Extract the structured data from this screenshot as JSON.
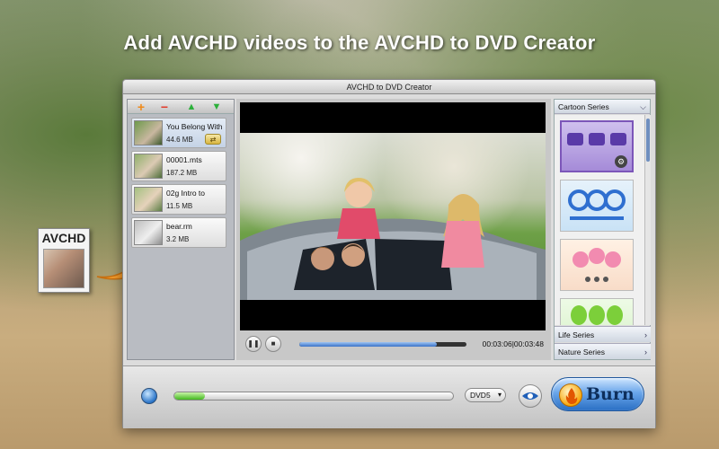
{
  "headline": "Add AVCHD videos to the AVCHD to DVD Creator",
  "file_icon": {
    "label": "AVCHD"
  },
  "window": {
    "title": "AVCHD to DVD Creator"
  },
  "file_list": {
    "toolbar": [
      "add-icon",
      "remove-icon",
      "move-up-icon",
      "move-down-icon"
    ],
    "items": [
      {
        "name": "You Belong With",
        "size": "44.6 MB",
        "selected": true
      },
      {
        "name": "00001.mts",
        "size": "187.2 MB",
        "selected": false
      },
      {
        "name": "02g Intro to",
        "size": "11.5 MB",
        "selected": false
      },
      {
        "name": "bear.rm",
        "size": "3.2 MB",
        "selected": false
      }
    ]
  },
  "player": {
    "time_current": "00:03:06",
    "time_total": "00:03:48",
    "time_readout": "00:03:06|00:03:48",
    "progress": 0.82
  },
  "menu_panel": {
    "header": "Cartoon Series",
    "series": [
      "Life Series",
      "Nature Series"
    ],
    "templates_count_visible": 4,
    "scroll": 0.0
  },
  "bottom_bar": {
    "disc_type": "DVD5",
    "capacity_used": 0.11,
    "burn_label": "Burn"
  },
  "colors": {
    "accent": "#2a6fc4",
    "capacity": "#43b820",
    "progress": "#3a72c8",
    "template_selected": "#7c56b9"
  }
}
